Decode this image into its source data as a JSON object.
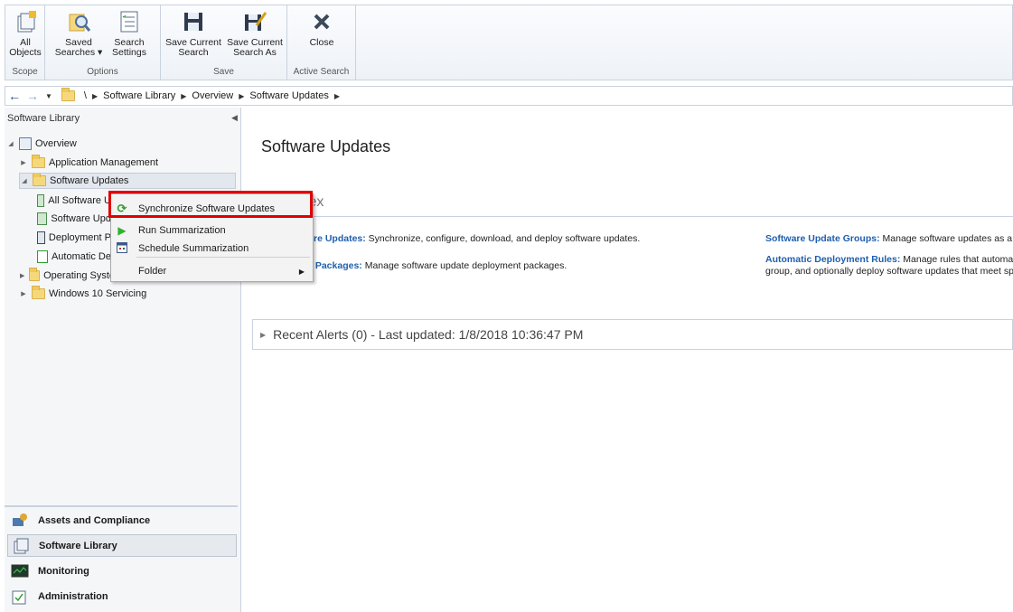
{
  "ribbon": {
    "groups": [
      {
        "name": "Scope",
        "buttons": [
          {
            "label1": "All",
            "label2": "Objects"
          }
        ]
      },
      {
        "name": "Options",
        "buttons": [
          {
            "label1": "Saved",
            "label2": "Searches ▾"
          },
          {
            "label1": "Search",
            "label2": "Settings"
          }
        ]
      },
      {
        "name": "Save",
        "buttons": [
          {
            "label1": "Save Current",
            "label2": "Search"
          },
          {
            "label1": "Save Current",
            "label2": "Search As"
          }
        ]
      },
      {
        "name": "Active Search",
        "buttons": [
          {
            "label1": "Close",
            "label2": ""
          }
        ]
      }
    ]
  },
  "address": {
    "root": "\\",
    "crumbs": [
      "Software Library",
      "Overview",
      "Software Updates"
    ]
  },
  "leftpane": {
    "title": "Software Library",
    "tree": [
      {
        "label": "Overview"
      },
      {
        "label": "Application Management"
      },
      {
        "label": "Software Updates"
      },
      {
        "label": "All Software U"
      },
      {
        "label": "Software Upd"
      },
      {
        "label": "Deployment P"
      },
      {
        "label": "Automatic De"
      },
      {
        "label": "Operating Syste"
      },
      {
        "label": "Windows 10 Servicing"
      }
    ],
    "workspaces": [
      {
        "label": "Assets and Compliance"
      },
      {
        "label": "Software Library"
      },
      {
        "label": "Monitoring"
      },
      {
        "label": "Administration"
      }
    ]
  },
  "main": {
    "title": "Software Updates",
    "section": "tion Index",
    "items": [
      {
        "link": "re Updates:",
        "text": " Synchronize, configure, download, and deploy software updates."
      },
      {
        "link": "nt Packages:",
        "text": " Manage software update deployment packages."
      },
      {
        "link": "Software Update Groups:",
        "text": " Manage software updates as a gr"
      },
      {
        "link": "Automatic Deployment Rules:",
        "text": " Manage rules that automatic",
        "line2": "group, and optionally deploy software updates that meet sp"
      }
    ],
    "alerts": "Recent Alerts (0) - Last updated: 1/8/2018 10:36:47 PM"
  },
  "context_menu": {
    "items": [
      {
        "label": "Synchronize Software Updates"
      },
      {
        "label": "Run Summarization"
      },
      {
        "label": "Schedule Summarization"
      },
      {
        "label": "Folder"
      }
    ]
  }
}
